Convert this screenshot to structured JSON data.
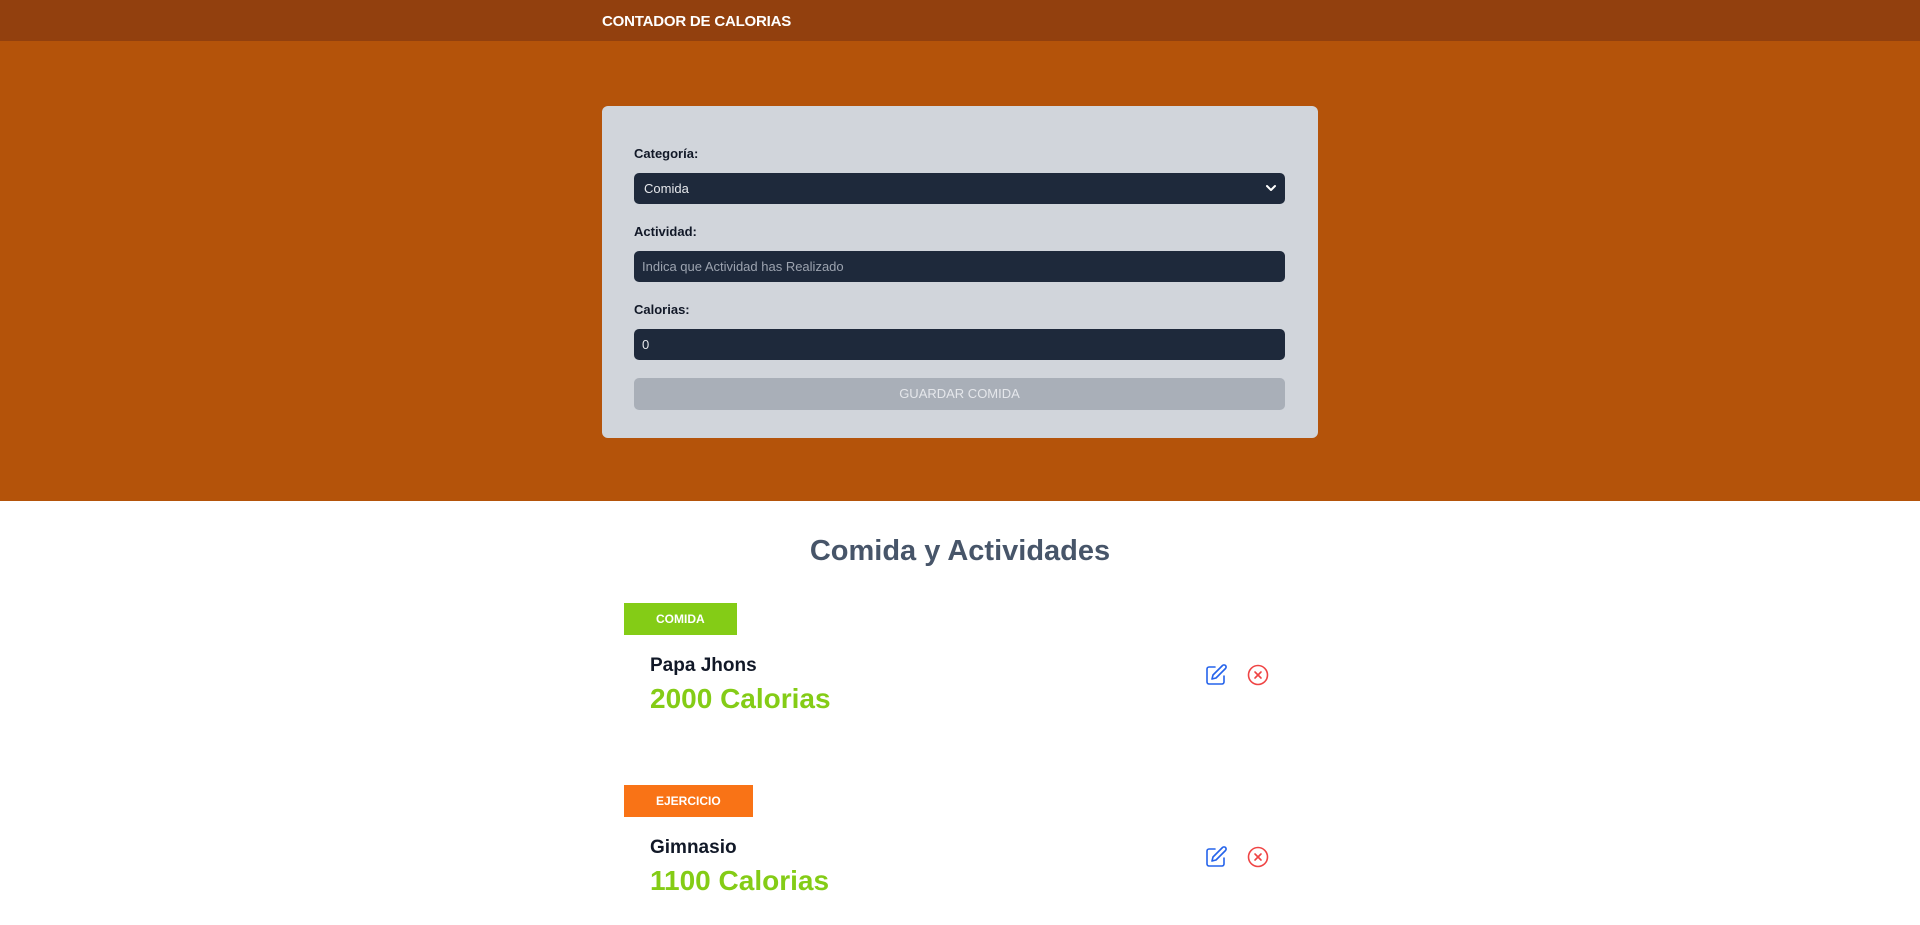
{
  "header": {
    "title": "CONTADOR DE CALORIAS"
  },
  "form": {
    "category_label": "Categoría:",
    "category_value": "Comida",
    "activity_label": "Actividad:",
    "activity_placeholder": "Indica que Actividad has Realizado",
    "calories_label": "Calorias:",
    "calories_value": "0",
    "save_label": "GUARDAR COMIDA"
  },
  "list": {
    "title": "Comida y Actividades",
    "items": [
      {
        "badge": "COMIDA",
        "name": "Papa Jhons",
        "calories": "2000 Calorias"
      },
      {
        "badge": "EJERCICIO",
        "name": "Gimnasio",
        "calories": "1100 Calorias"
      }
    ]
  },
  "icons": {
    "edit": "pencil-square-icon",
    "delete": "x-circle-icon"
  },
  "colors": {
    "header_bg": "#92400e",
    "hero_bg": "#b4530a",
    "comida_badge": "#84cc16",
    "ejercicio_badge": "#f97316",
    "calories_text": "#84cc16",
    "edit_icon": "#2563eb",
    "delete_icon": "#ef4444"
  }
}
